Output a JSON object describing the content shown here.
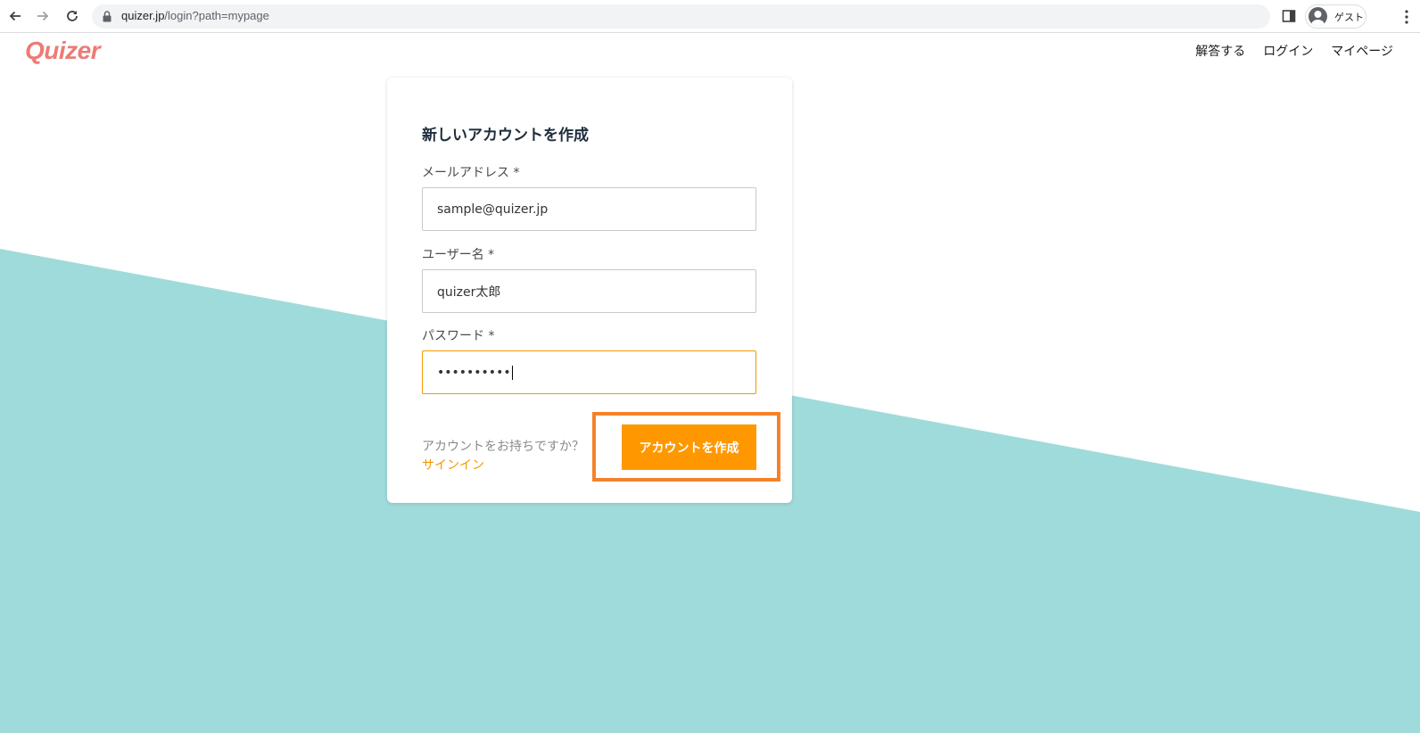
{
  "browser": {
    "url_host": "quizer.jp",
    "url_path": "/login?path=mypage",
    "profile_label": "ゲスト"
  },
  "site": {
    "logo": "Quizer",
    "nav": [
      "解答する",
      "ログイン",
      "マイページ"
    ]
  },
  "form": {
    "title": "新しいアカウントを作成",
    "email_label": "メールアドレス *",
    "email_value": "sample@quizer.jp",
    "username_label": "ユーザー名 *",
    "username_value": "quizer太郎",
    "password_label": "パスワード *",
    "password_value": "••••••••••",
    "signin_question": "アカウントをお持ちですか？",
    "signin_link": "サインイン",
    "submit_label": "アカウントを作成"
  },
  "colors": {
    "brand": "#ec7b76",
    "accent": "#ff9800",
    "background_shape": "#a0dbdb",
    "highlight": "#f5822a"
  }
}
